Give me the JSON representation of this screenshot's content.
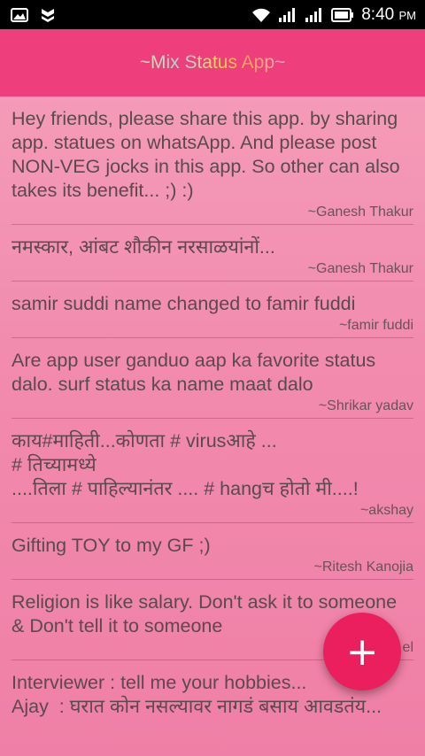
{
  "status_bar": {
    "time": "8:40",
    "ampm": "PM",
    "icons": [
      "image-icon",
      "shield-icon",
      "wifi-icon",
      "signal-icon",
      "signal-icon",
      "battery-icon"
    ]
  },
  "app_bar": {
    "title": "~Mix Status App~"
  },
  "posts": [
    {
      "text": "Hey friends, please share this app. by sharing app. statues on whatsApp. And please post NON-VEG jocks in this app. So other can also takes its benefit... ;) :)",
      "author": "~Ganesh Thakur"
    },
    {
      "text": "नमस्कार, आंबट शौकीन नरसाळयांनों...",
      "author": "~Ganesh Thakur"
    },
    {
      "text": "samir suddi name changed to famir fuddi",
      "author": "~famir fuddi"
    },
    {
      "text": "Are app user ganduo aap ka favorite status dalo. surf status ka name maat dalo",
      "author": "~Shrikar yadav"
    },
    {
      "text": "काय#माहिती...कोणता # virusआहे ...\n# तिच्यामध्ये\n....तिला # पाहिल्यानंतर .... # hangच होतो मी....!",
      "author": "~akshay"
    },
    {
      "text": "Gifting TOY to my GF ;)",
      "author": "~Ritesh Kanojia"
    },
    {
      "text": "Religion is like salary. Don't ask it to someone & Don't tell it to someone",
      "author": "~S... el"
    },
    {
      "text": "Interviewer : tell me your hobbies...\nAjay  : घरात कोन नसल्यावर नागडं बसाय आवडतंय...",
      "author": ""
    }
  ],
  "fab": {
    "label": "+"
  }
}
